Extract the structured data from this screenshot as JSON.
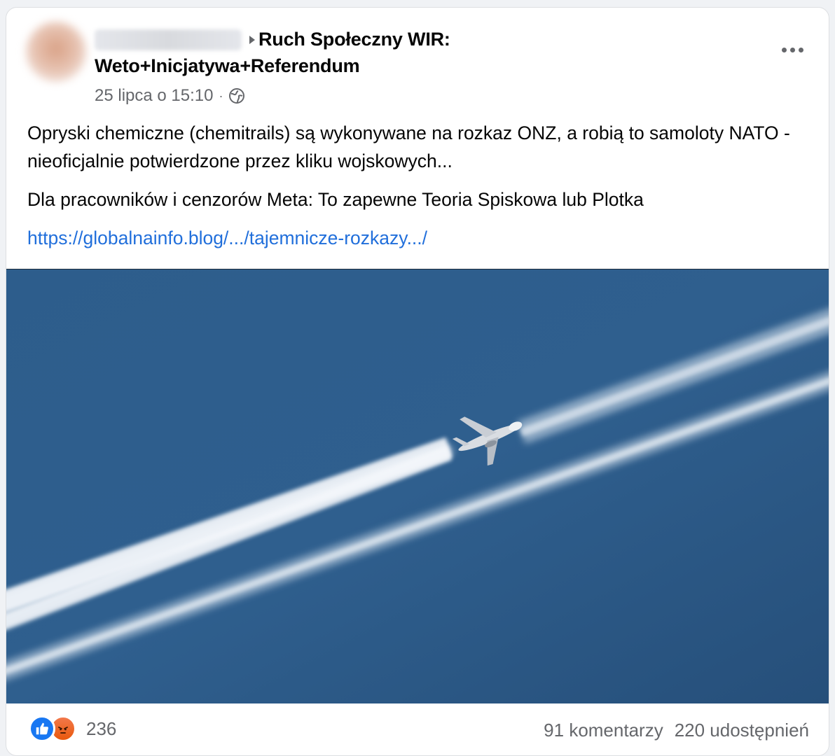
{
  "post": {
    "author_redacted": true,
    "group_name_line1": "Ruch Społeczny WIR:",
    "group_name_line2": "Weto+Inicjatywa+Referendum",
    "timestamp": "25 lipca o 15:10",
    "privacy_icon": "globe-icon",
    "paragraph_1": "Opryski chemiczne (chemitrails) są wykonywane na rozkaz ONZ, a robią to samoloty NATO - nieoficjalnie potwierdzone przez kliku wojskowych...",
    "paragraph_2": "Dla pracowników i cenzorów Meta: To zapewne Teoria Spiskowa lub Plotka",
    "link_text": "https://globalnainfo.blog/.../tajemnicze-rozkazy.../",
    "image_subject": "airplane-with-contrails"
  },
  "footer": {
    "reaction_icons": [
      "like-icon",
      "angry-icon"
    ],
    "reaction_count": "236",
    "comments": "91 komentarzy",
    "shares": "220 udostępnień"
  },
  "colors": {
    "link": "#216fdb",
    "muted": "#65676b",
    "like": "#1877f2",
    "angry": "#e9590c",
    "sky": "#2f5f8e"
  }
}
